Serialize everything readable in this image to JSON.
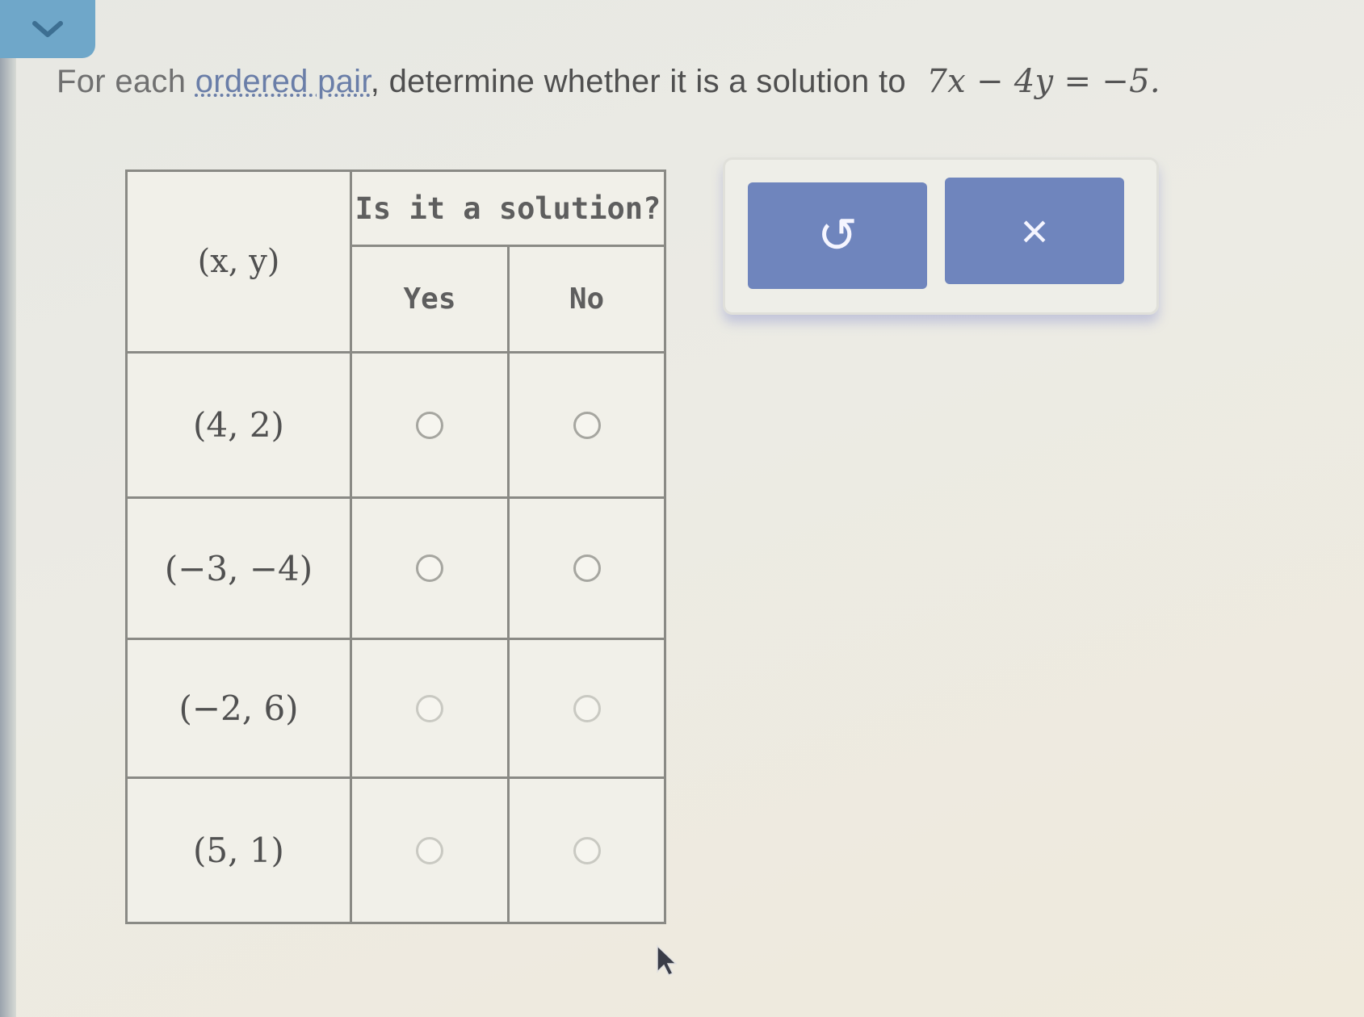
{
  "prompt": {
    "lead": "For each",
    "link": "ordered pair",
    "text": ", determine whether it is a solution to",
    "equation": "7x − 4y = −5."
  },
  "table": {
    "header_question": "Is it a solution?",
    "header_pair": "(x, y)",
    "header_yes": "Yes",
    "header_no": "No",
    "rows": [
      {
        "pair": "(4, 2)"
      },
      {
        "pair": "(−3, −4)"
      },
      {
        "pair": "(−2, 6)"
      },
      {
        "pair": "(5, 1)"
      }
    ]
  },
  "toolbar": {
    "undo_icon": "undo-icon",
    "undo_glyph": "↺",
    "clear_icon": "close-icon",
    "clear_glyph": "×"
  },
  "colors": {
    "button_fill": "#6f85bd",
    "collapse_tab": "#6fa7c9",
    "link": "#6a7ea8"
  }
}
